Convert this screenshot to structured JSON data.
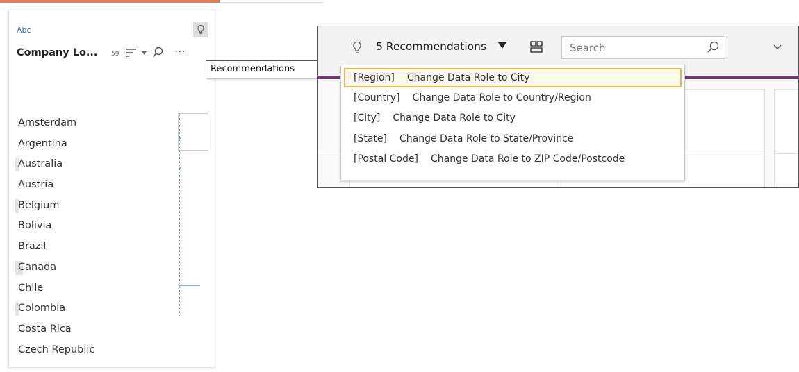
{
  "profile_card": {
    "type_label": "Abc",
    "field_name": "Company Lo...",
    "value_count": "59",
    "values": [
      {
        "label": "Amsterdam",
        "bar": 0
      },
      {
        "label": "Argentina",
        "bar": 0
      },
      {
        "label": "Australia",
        "bar": 0.08
      },
      {
        "label": "Austria",
        "bar": 0
      },
      {
        "label": "Belgium",
        "bar": 0.05
      },
      {
        "label": "Bolivia",
        "bar": 0
      },
      {
        "label": "Brazil",
        "bar": 0
      },
      {
        "label": "Canada",
        "bar": 0.14
      },
      {
        "label": "Chile",
        "bar": 0
      },
      {
        "label": "Colombia",
        "bar": 0.03
      },
      {
        "label": "Costa Rica",
        "bar": 0
      },
      {
        "label": "Czech Republic",
        "bar": 0
      }
    ],
    "icons": {
      "bulb": "lightbulb-icon",
      "sort": "sort-icon",
      "search": "search-icon",
      "more": "more-icon"
    }
  },
  "tooltip": {
    "text": "Recommendations"
  },
  "toolbar": {
    "recommendations_label": "5 Recommendations",
    "search_placeholder": "Search"
  },
  "recommendations": [
    {
      "field": "[Region]",
      "action": "Change Data Role to City",
      "selected": true
    },
    {
      "field": "[Country]",
      "action": "Change Data Role to Country/Region",
      "selected": false
    },
    {
      "field": "[City]",
      "action": "Change Data Role to City",
      "selected": false
    },
    {
      "field": "[State]",
      "action": "Change Data Role to State/Province",
      "selected": false
    },
    {
      "field": "[Postal Code]",
      "action": "Change Data Role to ZIP Code/Postcode",
      "selected": false
    }
  ],
  "colors": {
    "accent_purple": "#6c3a6e",
    "type_blue": "#2a6ac9",
    "selection_border": "#f0b646"
  }
}
